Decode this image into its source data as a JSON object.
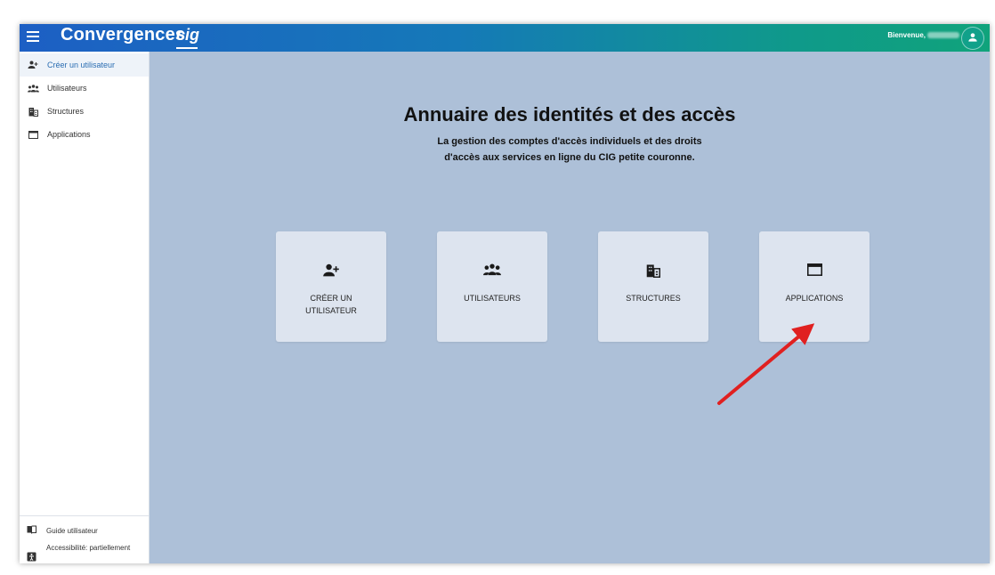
{
  "header": {
    "app_title": "Convergences",
    "logo_text": "cig",
    "welcome": "Bienvenue,",
    "gradient_start": "#1d5fc4",
    "gradient_end": "#10a37b"
  },
  "sidebar": {
    "items": [
      {
        "label": "Créer un utilisateur",
        "icon": "person-add-icon",
        "active": true
      },
      {
        "label": "Utilisateurs",
        "icon": "people-icon"
      },
      {
        "label": "Structures",
        "icon": "building-icon"
      },
      {
        "label": "Applications",
        "icon": "window-icon"
      }
    ],
    "bottom": [
      {
        "label": "Guide utilisateur",
        "icon": "book-icon"
      },
      {
        "label": "Accessibilité: partiellement",
        "icon": "accessibility-icon"
      }
    ]
  },
  "main": {
    "title": "Annuaire des identités et des accès",
    "subtitle": "La gestion des comptes d'accès individuels et des droits d'accès aux services en ligne du CIG petite couronne.",
    "background": "#adc0d8",
    "cards": [
      {
        "label": "CRÉER UN UTILISATEUR",
        "icon": "person-add-icon"
      },
      {
        "label": "UTILISATEURS",
        "icon": "people-icon"
      },
      {
        "label": "STRUCTURES",
        "icon": "building-icon"
      },
      {
        "label": "APPLICATIONS",
        "icon": "window-icon"
      }
    ]
  },
  "annotation": {
    "arrow_color": "#e02020"
  }
}
